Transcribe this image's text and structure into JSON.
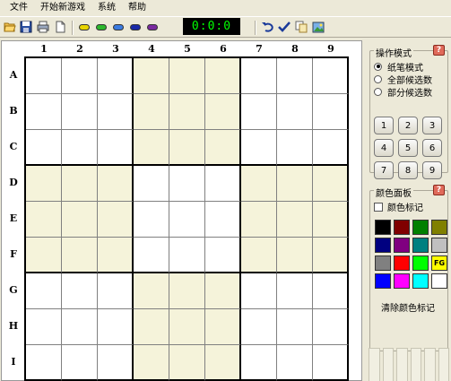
{
  "menu": [
    "文件",
    "开始新游戏",
    "系统",
    "帮助"
  ],
  "toolbar": {
    "timer": "0:0:0",
    "icons": [
      "open-folder-icon",
      "save-icon",
      "print-icon",
      "new-page-icon",
      "yellow-pill-icon",
      "green-pill-icon",
      "blue-pill-icon",
      "navy-pill-icon",
      "purple-pill-icon",
      "undo-icon",
      "check-icon",
      "copy-icon",
      "image-icon"
    ],
    "pill_colors": [
      "#e8d400",
      "#2db82d",
      "#3a7be0",
      "#1a2aa8",
      "#7a2aa0"
    ]
  },
  "board": {
    "columns": [
      "1",
      "2",
      "3",
      "4",
      "5",
      "6",
      "7",
      "8",
      "9"
    ],
    "rows": [
      "A",
      "B",
      "C",
      "D",
      "E",
      "F",
      "G",
      "H",
      "I"
    ],
    "shade_color": "#f5f3da"
  },
  "mode_panel": {
    "title": "操作模式",
    "help": "?",
    "options": [
      "纸笔模式",
      "全部候选数",
      "部分候选数"
    ],
    "selected_index": 0,
    "numbers": [
      "1",
      "2",
      "3",
      "4",
      "5",
      "6",
      "7",
      "8",
      "9"
    ]
  },
  "color_panel": {
    "title": "颜色面板",
    "help": "?",
    "checkbox_label": "颜色标记",
    "checked": false,
    "colors": [
      "#000000",
      "#800000",
      "#008000",
      "#808000",
      "#000080",
      "#800080",
      "#008080",
      "#c0c0c0",
      "#808080",
      "#ff0000",
      "#00ff00",
      "#ffff00",
      "#0000ff",
      "#ff00ff",
      "#00ffff",
      "#ffffff"
    ],
    "fg_label": "FG",
    "clear_label": "清除颜色标记"
  }
}
